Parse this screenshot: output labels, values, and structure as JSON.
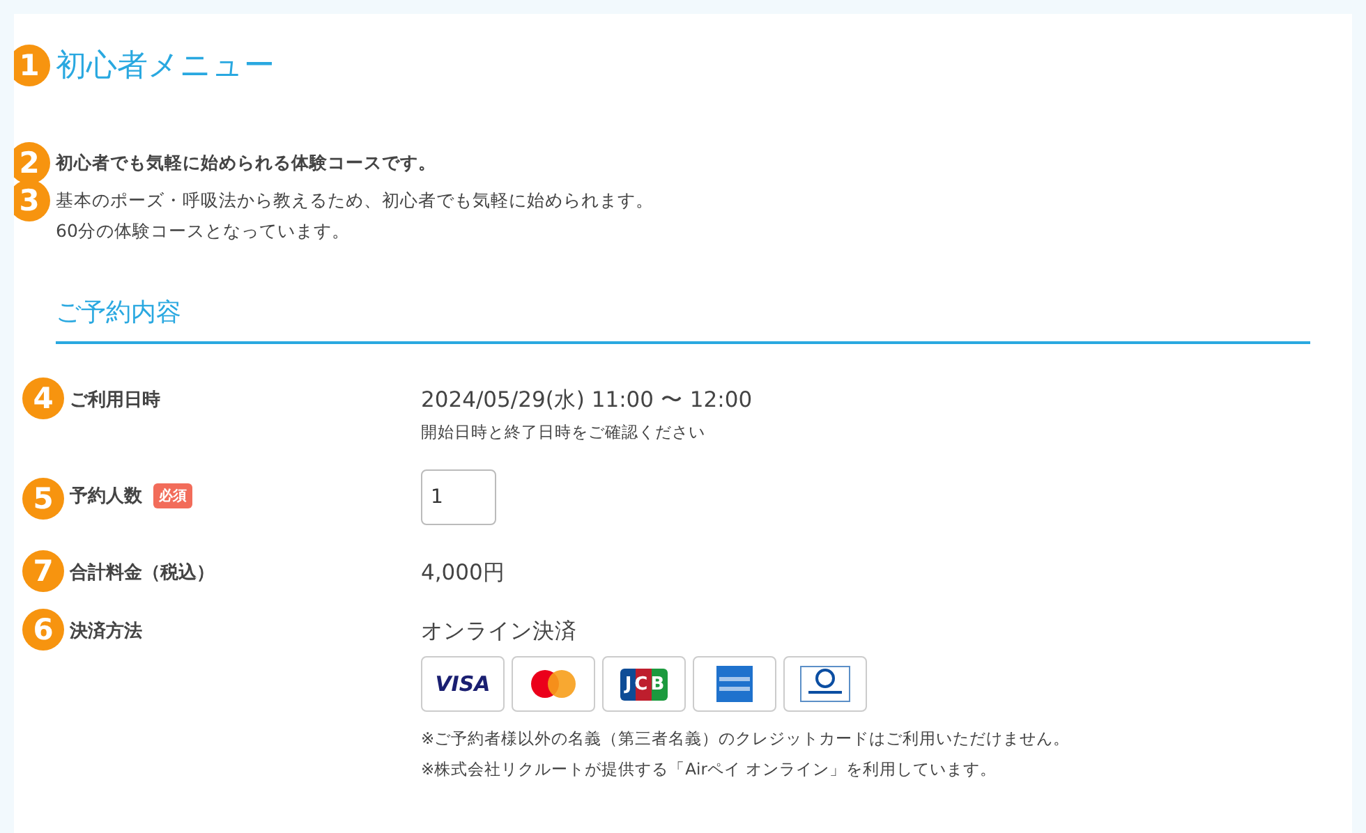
{
  "title": {
    "marker": "1",
    "text": "初心者メニュー"
  },
  "lead": {
    "marker": "2",
    "text": "初心者でも気軽に始められる体験コースです。"
  },
  "description": {
    "marker": "3",
    "lines": [
      "基本のポーズ・呼吸法から教えるため、初心者でも気軽に始められます。",
      "60分の体験コースとなっています。"
    ]
  },
  "section_title": "ご予約内容",
  "fields": [
    {
      "kind": "text",
      "marker": "4",
      "label": "ご利用日時",
      "value": "2024/05/29(水) 11:00 〜 12:00",
      "note": "開始日時と終了日時をご確認ください"
    },
    {
      "kind": "input",
      "marker": "5",
      "label": "予約人数",
      "badge": "必須",
      "value": "1"
    },
    {
      "kind": "text",
      "marker": "7",
      "label": "合計料金（税込）",
      "value": "4,000円"
    },
    {
      "kind": "payment",
      "marker": "6",
      "label": "決済方法",
      "value": "オンライン決済",
      "cards": [
        {
          "kind": "visa",
          "label": "VISA"
        },
        {
          "kind": "mastercard"
        },
        {
          "kind": "jcb",
          "label": "JCB"
        },
        {
          "kind": "amex"
        },
        {
          "kind": "diners"
        }
      ],
      "notes": [
        "※ご予約者様以外の名義（第三者名義）のクレジットカードはご利用いただけません。",
        "※株式会社リクルートが提供する「Airペイ オンライン」を利用しています。"
      ]
    }
  ]
}
